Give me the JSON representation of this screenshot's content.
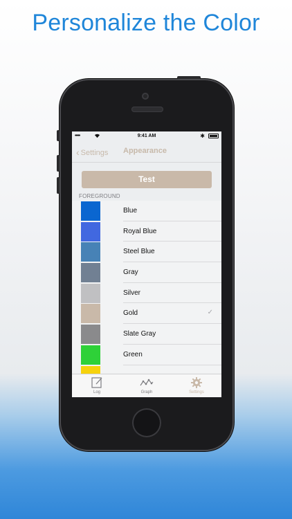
{
  "headline": "Personalize the Color",
  "status_bar": {
    "signal": "•••••",
    "wifi_icon": "wifi-icon",
    "time": "9:41 AM",
    "bluetooth": "✱",
    "battery_icon": "battery-icon"
  },
  "nav": {
    "back_label": "Settings",
    "title": "Appearance"
  },
  "test_button": "Test",
  "section": "FOREGROUND",
  "colors": [
    {
      "name": "Blue",
      "swatch": "#0a66d0",
      "selected": false
    },
    {
      "name": "Royal Blue",
      "swatch": "#4168e0",
      "selected": false
    },
    {
      "name": "Steel Blue",
      "swatch": "#4782b6",
      "selected": false
    },
    {
      "name": "Gray",
      "swatch": "#718093",
      "selected": false
    },
    {
      "name": "Silver",
      "swatch": "#c0c0c2",
      "selected": false
    },
    {
      "name": "Gold",
      "swatch": "#c9b9a9",
      "selected": true
    },
    {
      "name": "Slate Gray",
      "swatch": "#8a8a8c",
      "selected": false
    },
    {
      "name": "Green",
      "swatch": "#2ed138",
      "selected": false
    },
    {
      "name": "",
      "swatch": "#f6d20c",
      "selected": false
    }
  ],
  "tabs": [
    {
      "label": "Log",
      "icon": "log-icon",
      "active": false
    },
    {
      "label": "Graph",
      "icon": "graph-icon",
      "active": false
    },
    {
      "label": "Settings",
      "icon": "gear-icon",
      "active": true
    }
  ]
}
